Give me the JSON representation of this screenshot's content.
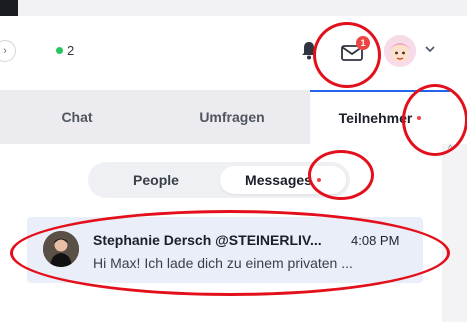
{
  "header": {
    "online_count": "2",
    "mail_badge": "1"
  },
  "tabs": [
    {
      "label": "Chat",
      "active": false
    },
    {
      "label": "Umfragen",
      "active": false
    },
    {
      "label": "Teilnehmer",
      "active": true,
      "has_dot": true
    }
  ],
  "segment": {
    "people_label": "People",
    "messages_label": "Messages"
  },
  "message": {
    "name": "Stephanie Dersch @STEINERLIV...",
    "time": "4:08 PM",
    "preview": "Hi Max! Ich lade dich zu einem privaten ..."
  },
  "colors": {
    "accent": "#2563eb",
    "online": "#22c55e",
    "badge": "#ef4444",
    "annotation": "#e3101b"
  }
}
